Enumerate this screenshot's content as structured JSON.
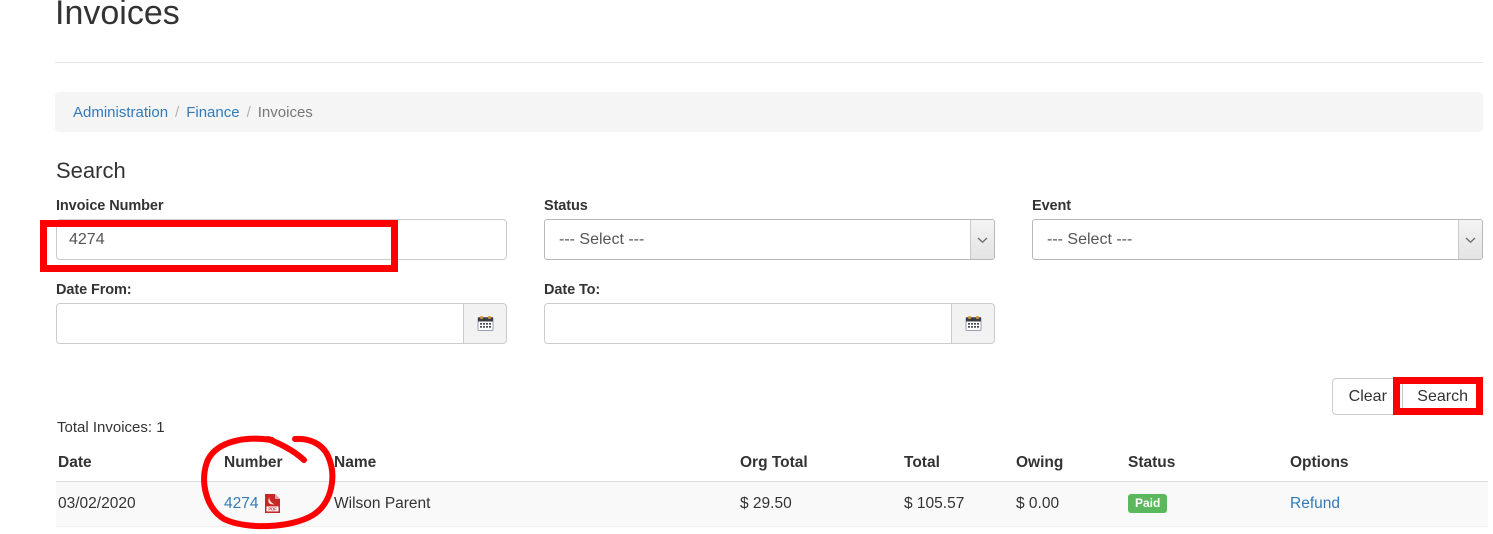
{
  "page": {
    "title": "Invoices"
  },
  "breadcrumb": {
    "items": [
      {
        "label": "Administration",
        "link": true
      },
      {
        "label": "Finance",
        "link": true
      },
      {
        "label": "Invoices",
        "link": false
      }
    ],
    "separator": "/"
  },
  "search": {
    "heading": "Search",
    "fields": {
      "invoice_number": {
        "label": "Invoice Number",
        "value": "4274",
        "placeholder": ""
      },
      "status": {
        "label": "Status",
        "value": "--- Select ---",
        "options": [
          "--- Select ---"
        ]
      },
      "event": {
        "label": "Event",
        "value": "--- Select ---",
        "options": [
          "--- Select ---"
        ]
      },
      "date_from": {
        "label": "Date From:",
        "value": "",
        "placeholder": "",
        "icon": "calendar-icon"
      },
      "date_to": {
        "label": "Date To:",
        "value": "",
        "placeholder": "",
        "icon": "calendar-icon"
      }
    },
    "buttons": {
      "clear": "Clear",
      "search": "Search"
    }
  },
  "results": {
    "total_text": "Total Invoices: 1",
    "columns": [
      "Date",
      "Number",
      "Name",
      "Org Total",
      "Total",
      "Owing",
      "Status",
      "Options"
    ],
    "rows": [
      {
        "date": "03/02/2020",
        "number": "4274",
        "number_icon": "pdf-icon",
        "name": "Wilson Parent",
        "org_total": "$ 29.50",
        "total": "$ 105.57",
        "owing": "$ 0.00",
        "status": "Paid",
        "options": "Refund"
      }
    ]
  },
  "colors": {
    "link": "#337ab7",
    "annotation": "#fe0000",
    "paid_badge": "#5cb85c",
    "breadcrumb_bg": "#f5f5f5",
    "row_bg": "#f9f9f9",
    "pdf_icon": "#c62828"
  },
  "annotations": [
    {
      "name": "invoice-number-highlight",
      "shape": "rectangle",
      "target": "invoice-number-input"
    },
    {
      "name": "search-button-highlight",
      "shape": "rectangle",
      "target": "search-button"
    },
    {
      "name": "number-column-circle",
      "shape": "ellipse",
      "target": "invoice-number-link"
    }
  ]
}
